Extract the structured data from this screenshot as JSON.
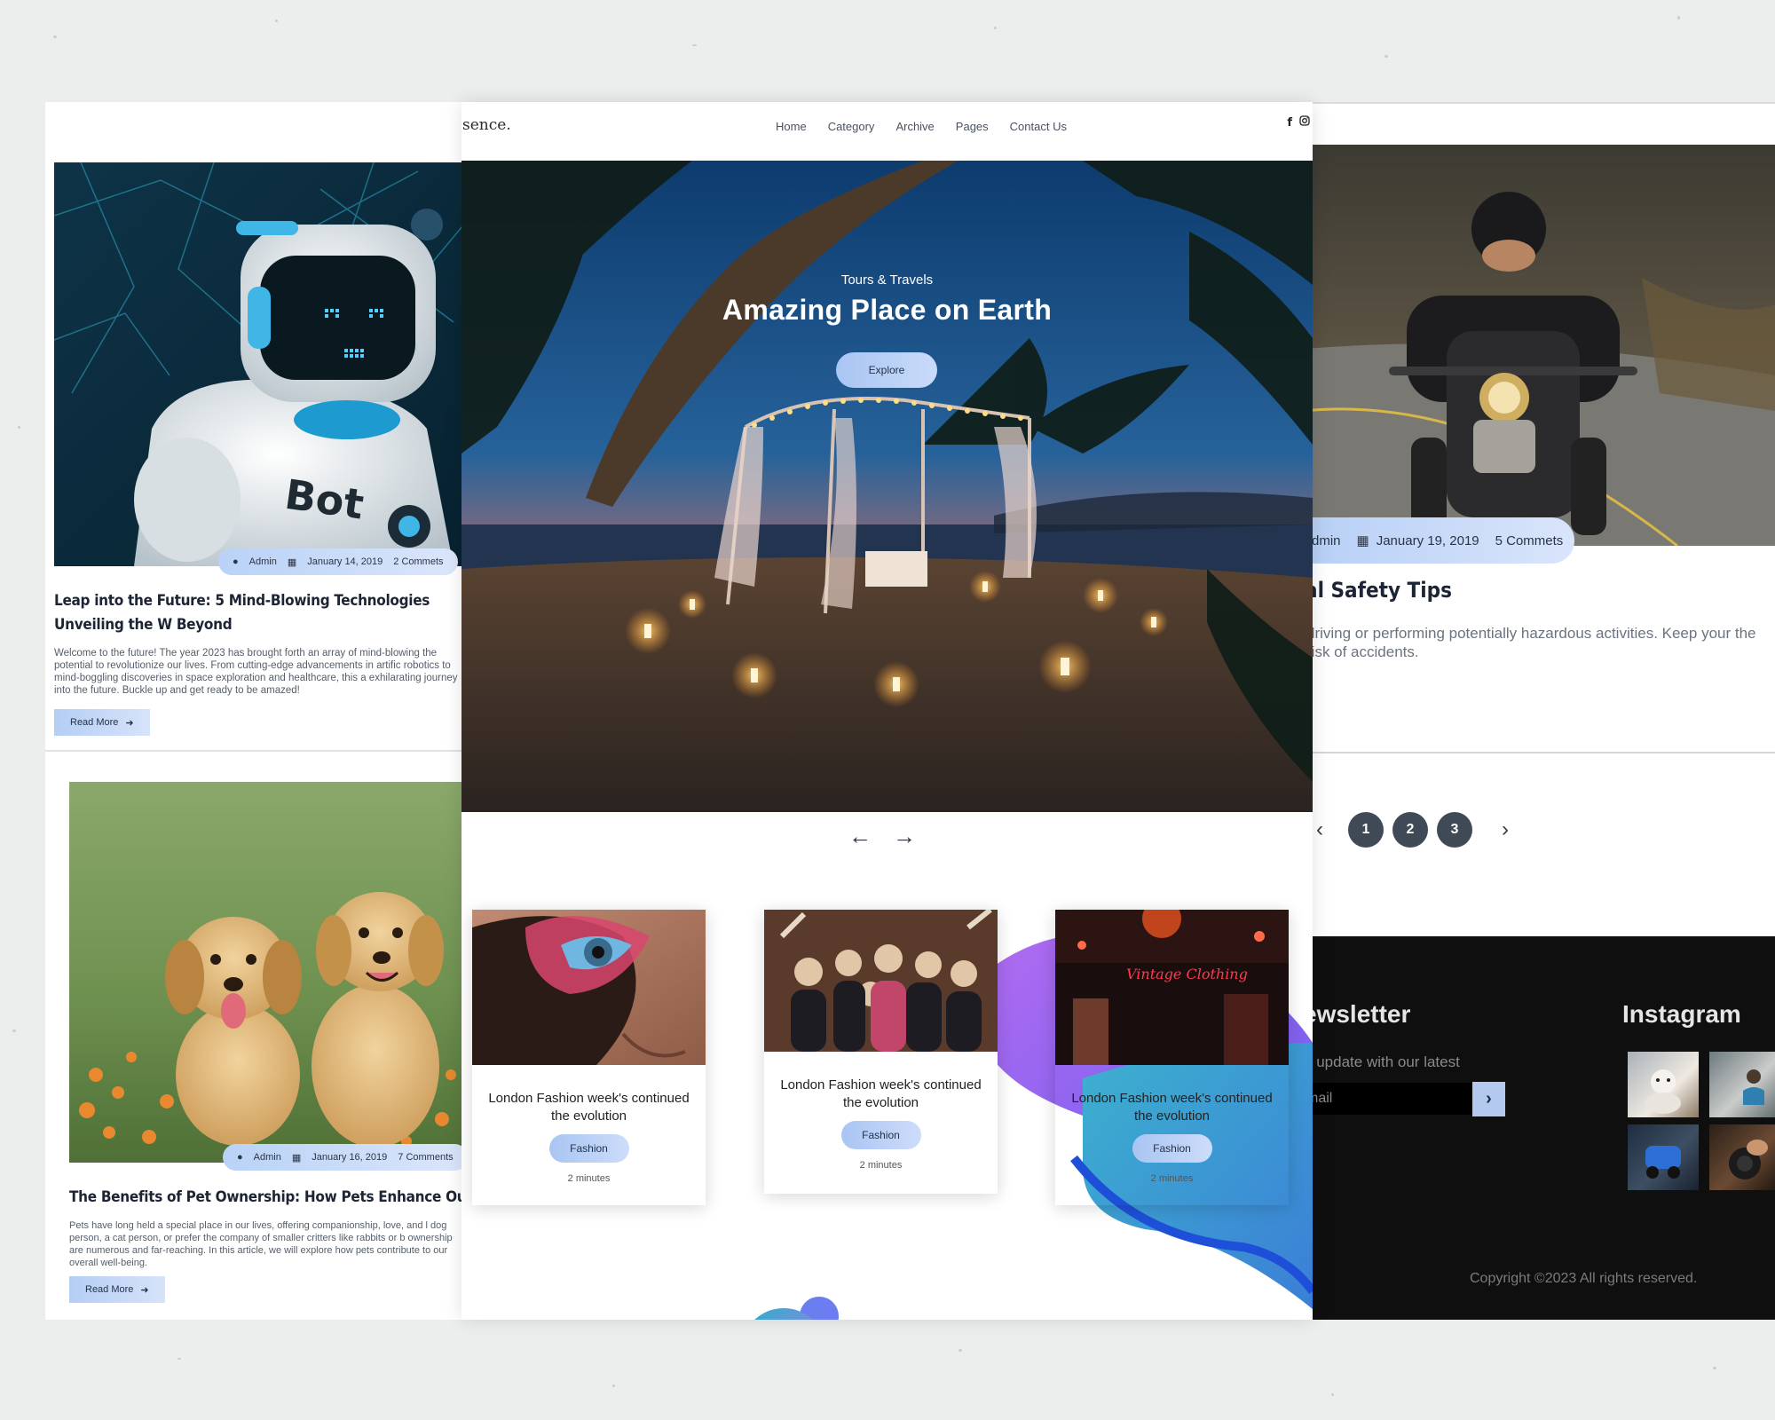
{
  "left_panel": {
    "posts": [
      {
        "meta": {
          "author": "Admin",
          "date": "January 14, 2019",
          "comments": "2 Commets"
        },
        "title": "Leap into the Future: 5 Mind-Blowing Technologies Unveiling the W Beyond",
        "excerpt": "Welcome to the future! The year 2023 has brought forth an array of mind-blowing the potential to revolutionize our lives. From cutting-edge advancements in artific robotics to mind-boggling discoveries in space exploration and healthcare, this a exhilarating journey into the future. Buckle up and get ready to be amazed!",
        "read_more": "Read More",
        "image_text": "Bot"
      },
      {
        "meta": {
          "author": "Admin",
          "date": "January 16, 2019",
          "comments": "7 Comments"
        },
        "title": "The Benefits of Pet Ownership: How Pets Enhance Our Lives",
        "excerpt": "Pets have long held a special place in our lives, offering companionship, love, and l dog person, a cat person, or prefer the company of smaller critters like rabbits or b ownership are numerous and far-reaching. In this article, we will explore how pets contribute to our overall well-being.",
        "read_more": "Read More"
      }
    ]
  },
  "center_panel": {
    "logo": "sence.",
    "nav": [
      "Home",
      "Category",
      "Archive",
      "Pages",
      "Contact Us"
    ],
    "social_icons": [
      "facebook-icon",
      "instagram-icon"
    ],
    "hero": {
      "category": "Tours & Travels",
      "title": "Amazing Place on Earth",
      "button": "Explore"
    },
    "slider_arrows": {
      "prev": "←",
      "next": "→"
    },
    "cards": [
      {
        "title": "London Fashion week's continued the evolution",
        "tag": "Fashion",
        "time": "2 minutes"
      },
      {
        "title": "London Fashion week's continued the evolution",
        "tag": "Fashion",
        "time": "2 minutes"
      },
      {
        "title": "London Fashion week's continued the evolution",
        "tag": "Fashion",
        "time": "2 minutes",
        "image_sign": "Vintage Clothing"
      }
    ]
  },
  "right_panel": {
    "meta": {
      "author": "dmin",
      "date": "January 19, 2019",
      "comments": "5 Commets"
    },
    "title": "al Safety Tips",
    "excerpt": "driving or performing potentially hazardous activities. Keep your the risk of accidents.",
    "pagination": {
      "prev": "‹",
      "pages": [
        "1",
        "2",
        "3"
      ],
      "next": "›"
    },
    "footer": {
      "newsletter_title": "ewsletter",
      "newsletter_text": "y update with our latest",
      "email_placeholder": "mail",
      "submit_icon": "chevron-right-icon",
      "instagram_title": "Instagram",
      "copyright": "Copyright ©2023 All rights reserved."
    }
  },
  "colors": {
    "accent": "#b7cff6",
    "dark": "#0f0f10",
    "page_number": "#3f4a56"
  }
}
